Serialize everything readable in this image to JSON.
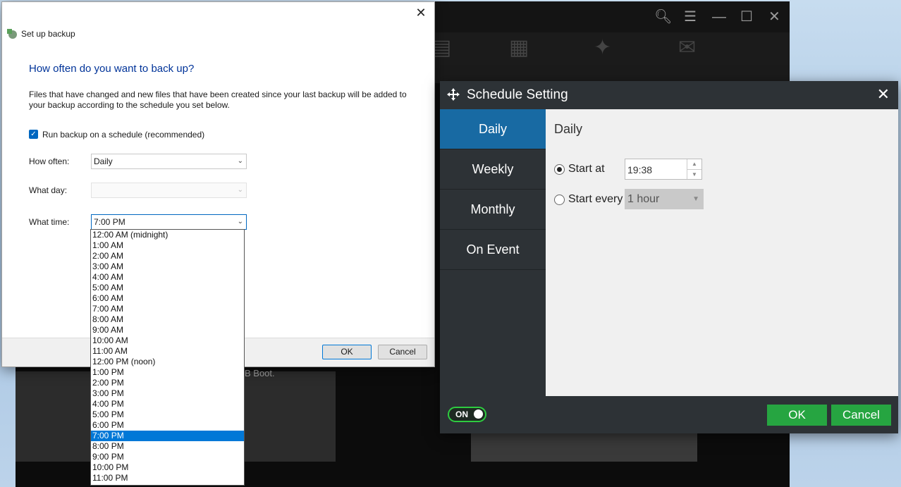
{
  "background_app": {
    "text_fragment": "B Boot."
  },
  "backup_dialog": {
    "title": "Set up backup",
    "heading": "How often do you want to back up?",
    "description": "Files that have changed and new files that have been created since your last backup will be added to your backup according to the schedule you set below.",
    "schedule_checkbox_label": "Run backup on a schedule (recommended)",
    "schedule_checked": true,
    "how_often_label": "How often:",
    "how_often_value": "Daily",
    "what_day_label": "What day:",
    "what_day_value": "",
    "what_time_label": "What time:",
    "what_time_value": "7:00 PM",
    "ok_label": "OK",
    "cancel_label": "Cancel",
    "time_options": [
      "12:00 AM (midnight)",
      "1:00 AM",
      "2:00 AM",
      "3:00 AM",
      "4:00 AM",
      "5:00 AM",
      "6:00 AM",
      "7:00 AM",
      "8:00 AM",
      "9:00 AM",
      "10:00 AM",
      "11:00 AM",
      "12:00 PM (noon)",
      "1:00 PM",
      "2:00 PM",
      "3:00 PM",
      "4:00 PM",
      "5:00 PM",
      "6:00 PM",
      "7:00 PM",
      "8:00 PM",
      "9:00 PM",
      "10:00 PM",
      "11:00 PM"
    ],
    "selected_time_index": 19
  },
  "schedule_dialog": {
    "title": "Schedule Setting",
    "nav": [
      "Daily",
      "Weekly",
      "Monthly",
      "On Event"
    ],
    "active_nav": "Daily",
    "content_heading": "Daily",
    "start_at_label": "Start at",
    "start_at_value": "19:38",
    "start_every_label": "Start every",
    "start_every_value": "1 hour",
    "toggle_label": "ON",
    "ok_label": "OK",
    "cancel_label": "Cancel",
    "accent_color": "#186aa3",
    "button_color": "#26a541"
  }
}
